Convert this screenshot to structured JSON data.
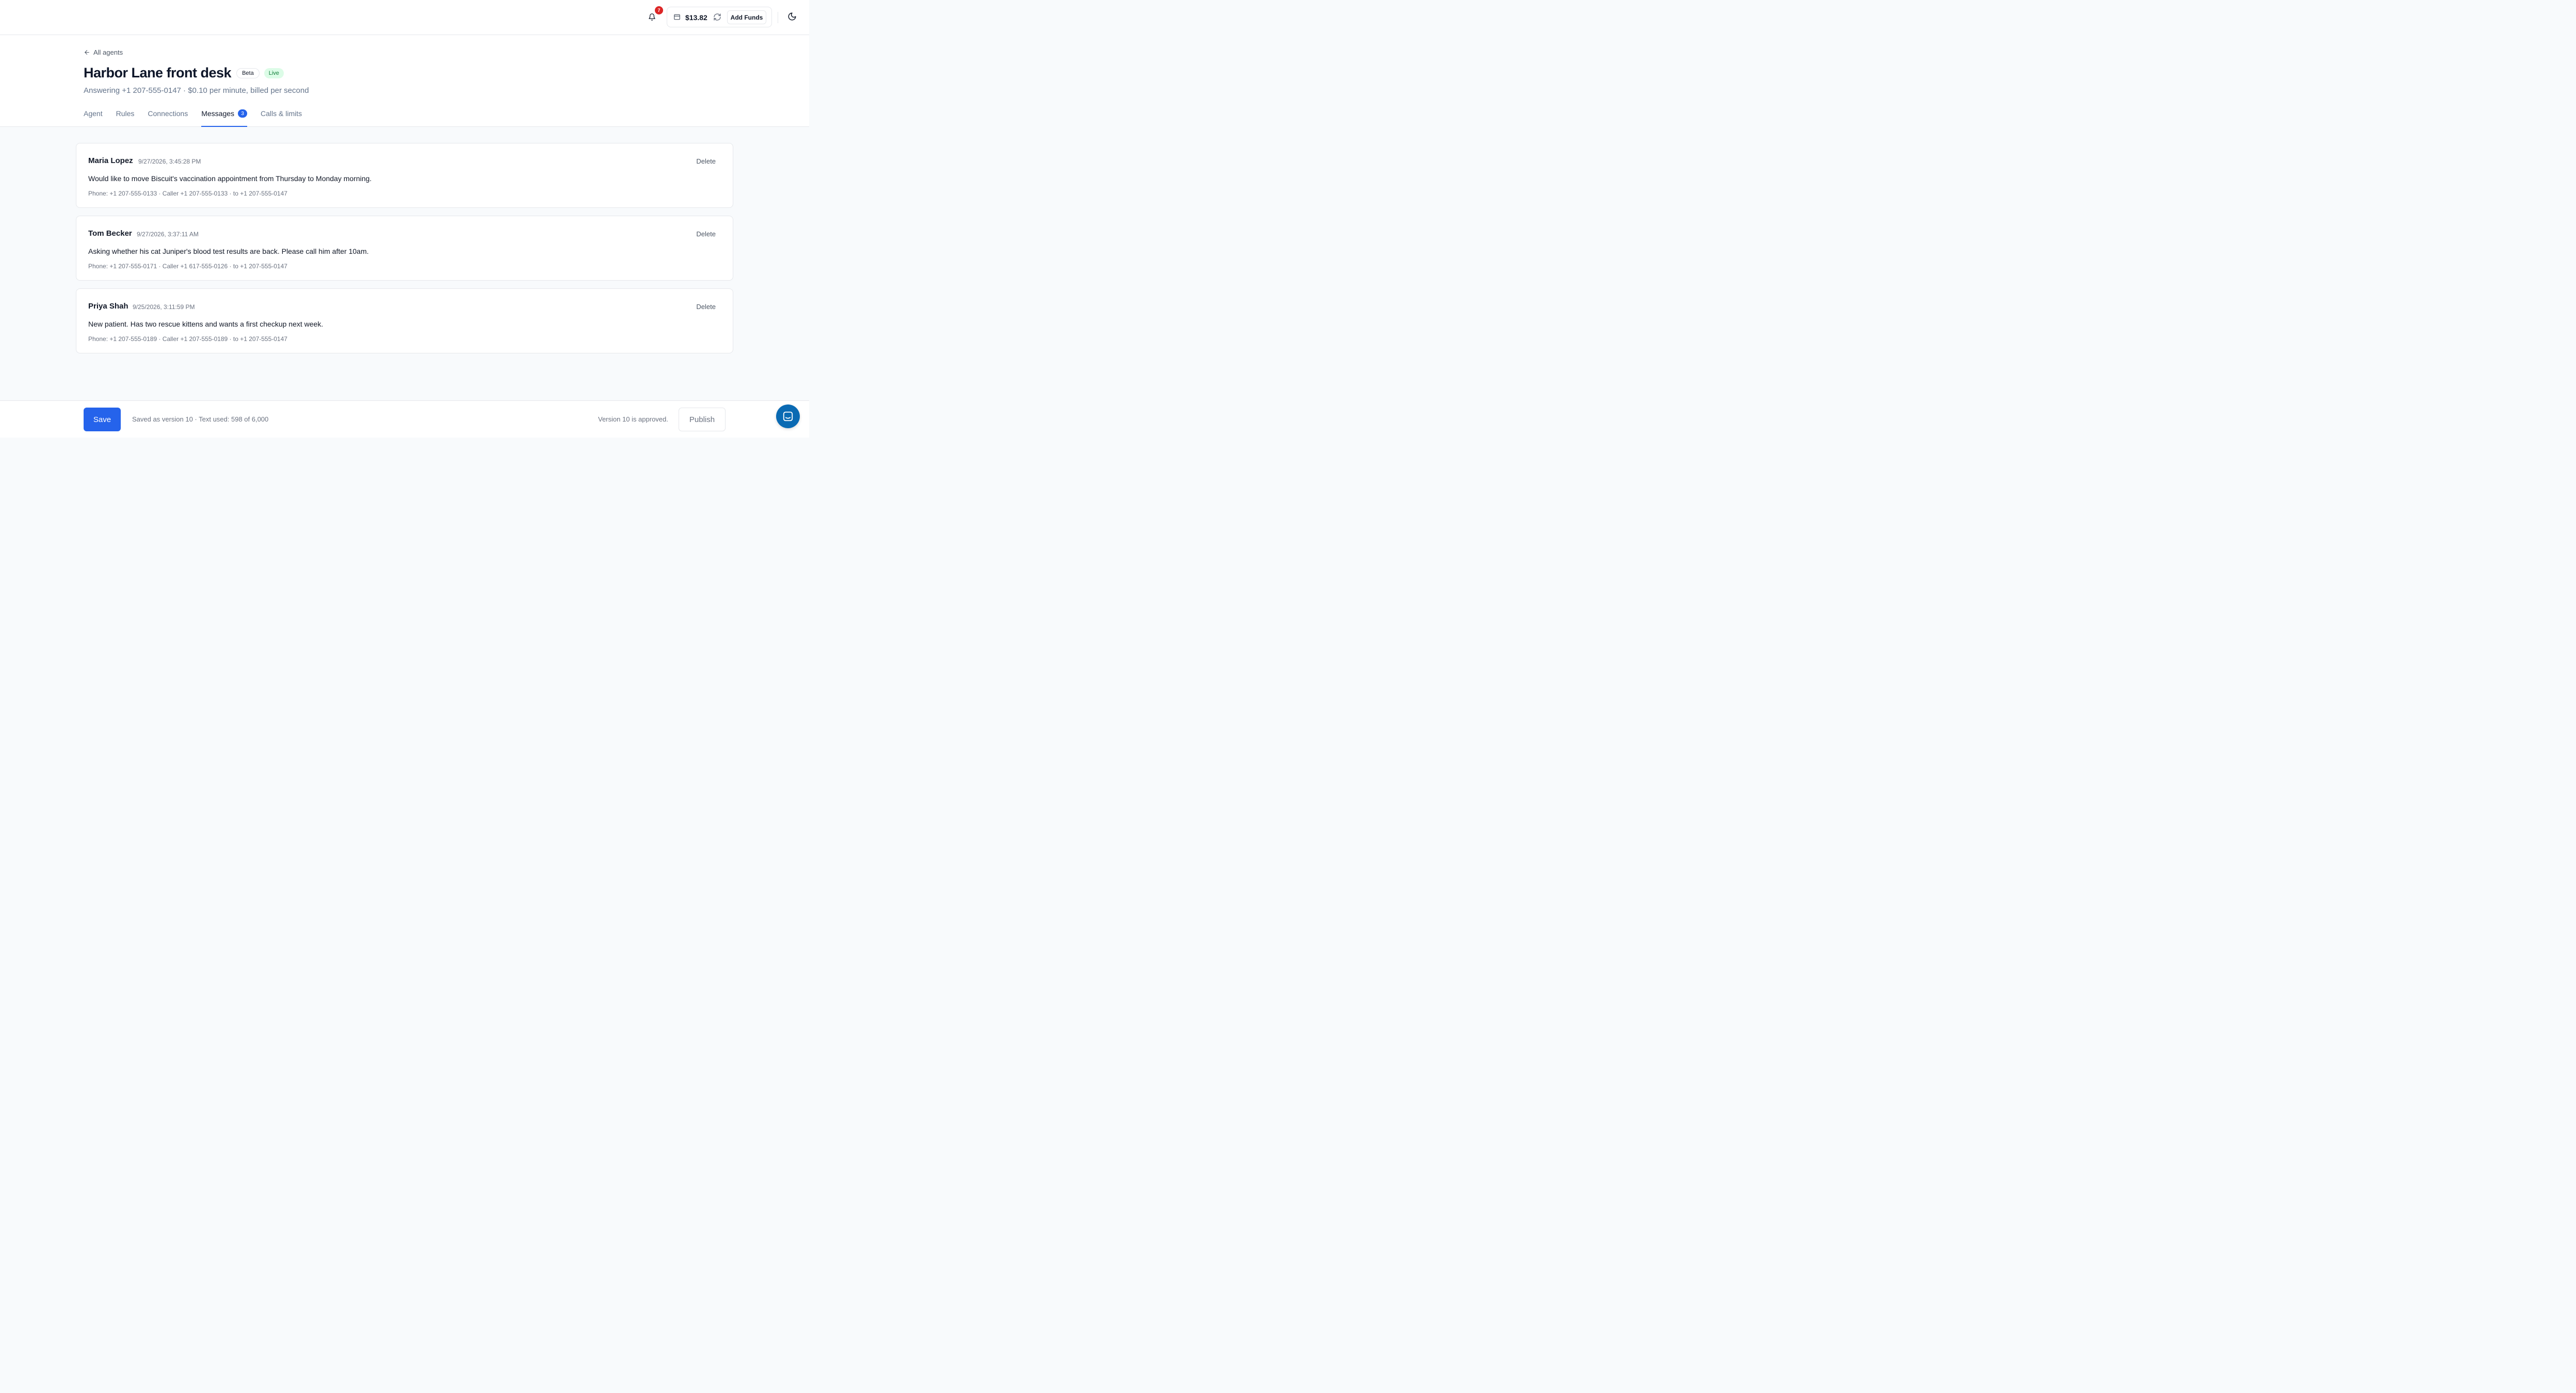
{
  "topbar": {
    "notifications_count": "7",
    "balance": "$13.82",
    "add_funds_label": "Add Funds",
    "icons": [
      "bell-icon",
      "card-icon",
      "refresh-icon",
      "moon-icon"
    ]
  },
  "header": {
    "back_label": "All agents",
    "title": "Harbor Lane front desk",
    "badges": {
      "beta": "Beta",
      "live": "Live"
    },
    "subtitle": "Answering +1 207-555-0147 · $0.10 per minute, billed per second",
    "tabs": [
      {
        "label": "Agent"
      },
      {
        "label": "Rules"
      },
      {
        "label": "Connections"
      },
      {
        "label": "Messages",
        "count": "3",
        "active": true
      },
      {
        "label": "Calls & limits"
      }
    ]
  },
  "messages": [
    {
      "name": "Maria Lopez",
      "time": "9/27/2026, 3:45:28 PM",
      "text": "Would like to move Biscuit's vaccination appointment from Thursday to Monday morning.",
      "meta": "Phone: +1 207-555-0133 · Caller +1 207-555-0133 · to +1 207-555-0147",
      "delete_label": "Delete"
    },
    {
      "name": "Tom Becker",
      "time": "9/27/2026, 3:37:11 AM",
      "text": "Asking whether his cat Juniper's blood test results are back. Please call him after 10am.",
      "meta": "Phone: +1 207-555-0171 · Caller +1 617-555-0126 · to +1 207-555-0147",
      "delete_label": "Delete"
    },
    {
      "name": "Priya Shah",
      "time": "9/25/2026, 3:11:59 PM",
      "text": "New patient. Has two rescue kittens and wants a first checkup next week.",
      "meta": "Phone: +1 207-555-0189 · Caller +1 207-555-0189 · to +1 207-555-0147",
      "delete_label": "Delete"
    }
  ],
  "footer": {
    "save_label": "Save",
    "save_status": "Saved as version 10 · Text used: 598 of 6,000",
    "approval_text": "Version 10 is approved.",
    "publish_label": "Publish"
  },
  "colors": {
    "accent": "#2563eb",
    "live_text": "#15803d",
    "live_bg": "#dcfce7",
    "alert": "#dc2626",
    "chat_fab": "#0a6ab3"
  }
}
